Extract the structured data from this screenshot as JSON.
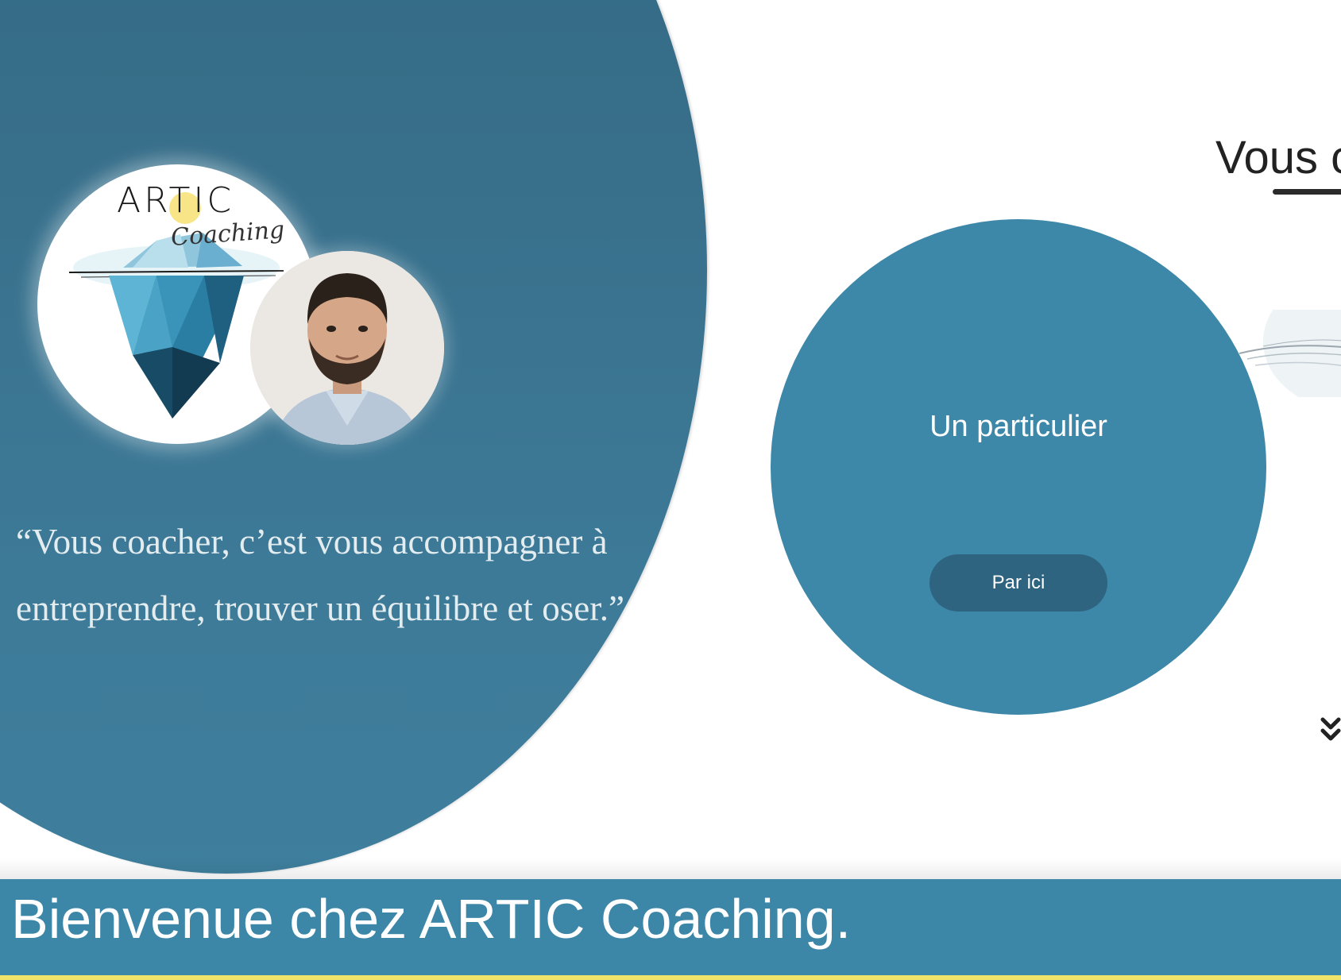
{
  "hero": {
    "logo": {
      "title": "ARTIC",
      "subtitle": "Coaching"
    },
    "quote": "“Vous coacher, c’est vous accompagner à entreprendre, trouver un équilibre et oser.”"
  },
  "particulier": {
    "title": "Un particulier",
    "button_label": "Par ici"
  },
  "right": {
    "heading_partial": "Vous c"
  },
  "footer_band": {
    "welcome": "Bienvenue chez ARTIC Coaching."
  },
  "colors": {
    "hero_blue": "#386f8a",
    "circle_blue": "#3d87a9",
    "button_blue": "#2e6480",
    "band_blue": "#3c86a8",
    "accent_yellow": "#f0e36a"
  },
  "icons": {
    "scroll_down": "double-chevron-down-icon"
  }
}
